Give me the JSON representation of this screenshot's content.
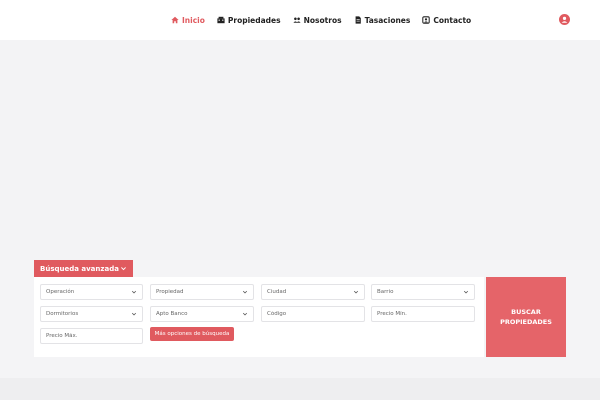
{
  "nav": {
    "items": [
      {
        "label": "Inicio",
        "icon": "home-icon",
        "active": true
      },
      {
        "label": "Propiedades",
        "icon": "building-icon",
        "active": false
      },
      {
        "label": "Nosotros",
        "icon": "users-icon",
        "active": false
      },
      {
        "label": "Tasaciones",
        "icon": "document-icon",
        "active": false
      },
      {
        "label": "Contacto",
        "icon": "contact-icon",
        "active": false
      }
    ],
    "user_icon": "user-circle-icon"
  },
  "search": {
    "tab_label": "Búsqueda avanzada",
    "operacion": "Operación",
    "propiedad": "Propiedad",
    "ciudad": "Ciudad",
    "barrio": "Barrio",
    "dormitorios": "Dormitorios",
    "apto_banco": "Apto Banco",
    "codigo_placeholder": "Código",
    "precio_min_placeholder": "Precio Mín.",
    "precio_max_placeholder": "Precio Máx.",
    "more_options_label": "Más opciones de búsqueda",
    "submit_label": "BUSCAR PROPIEDADES"
  },
  "colors": {
    "accent": "#e05a5f",
    "search_button": "#e56469",
    "background": "#f4f4f6"
  }
}
